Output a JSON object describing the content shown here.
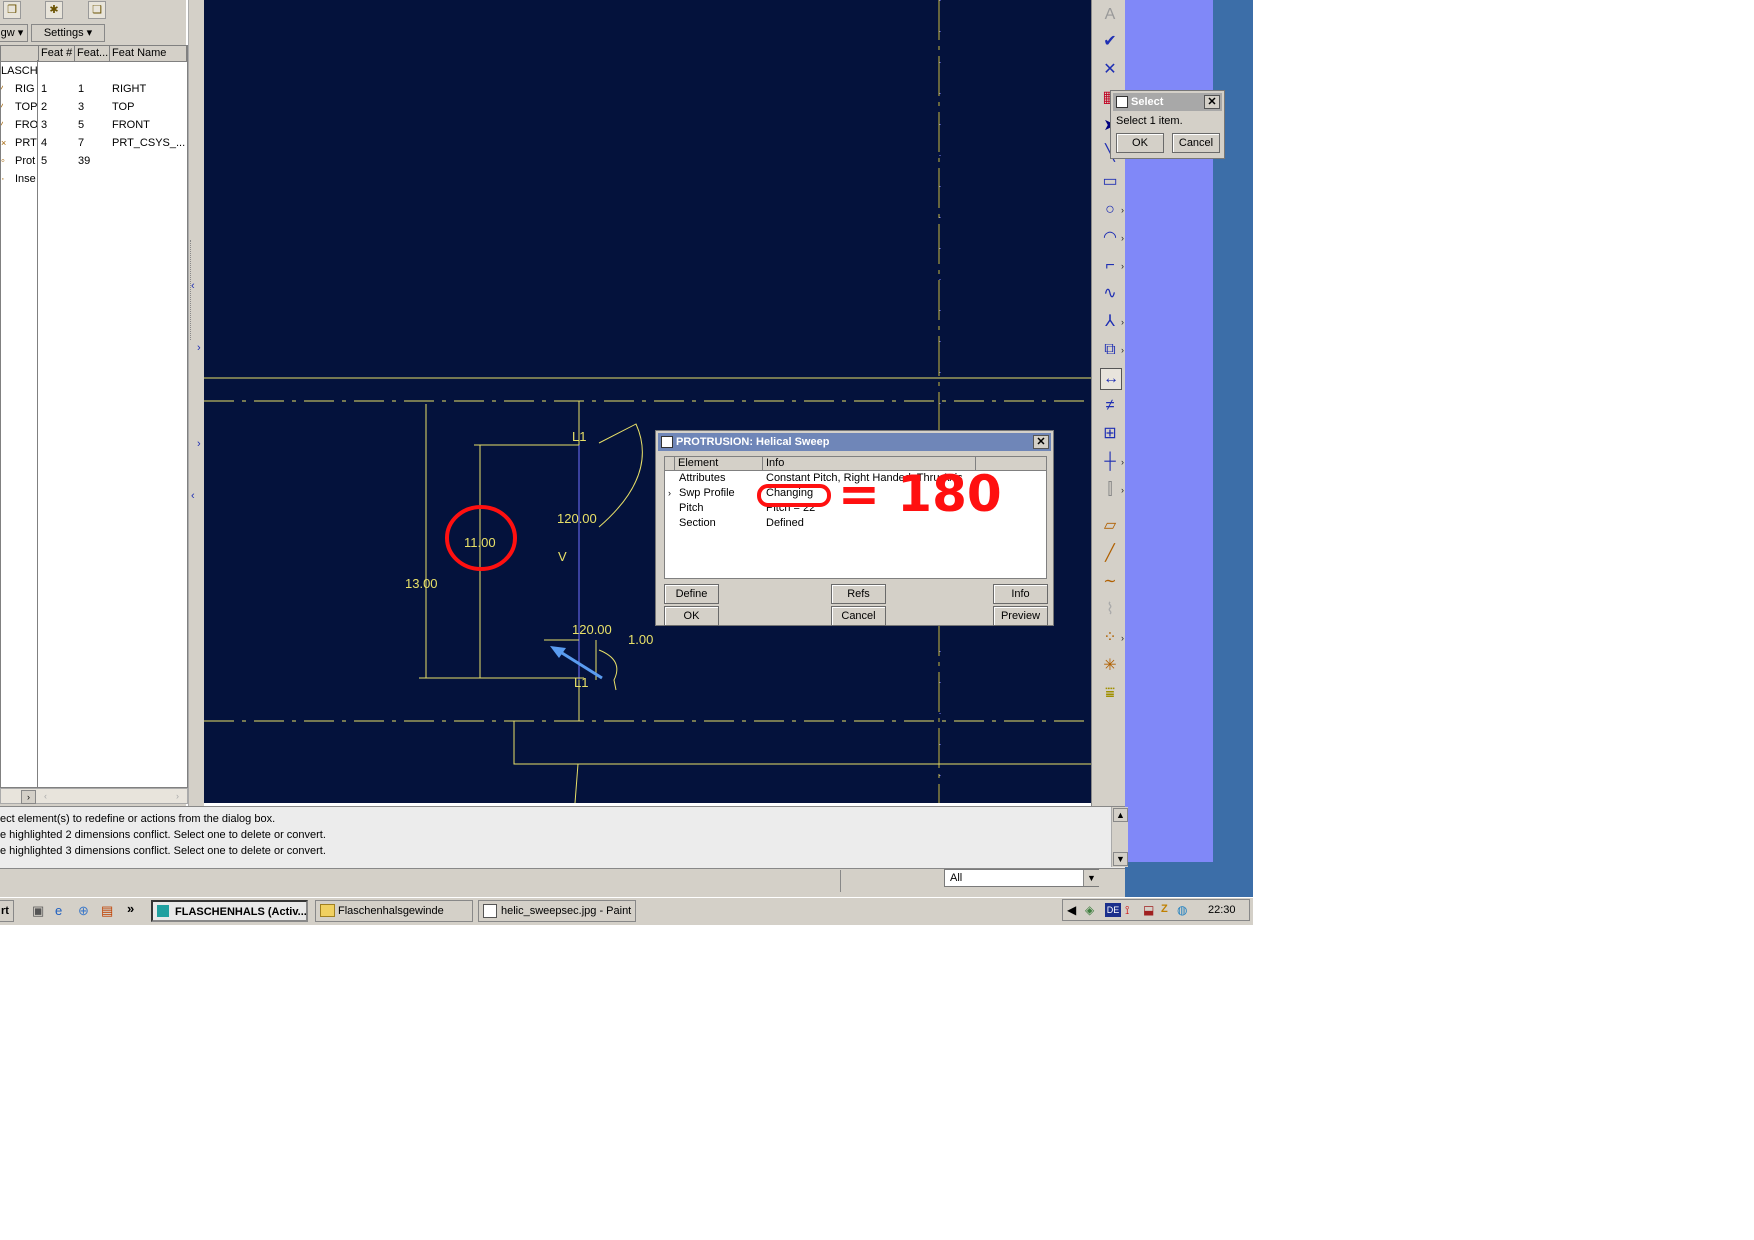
{
  "model_tree": {
    "settings_menu": "Settings",
    "view_menu": "gw",
    "columns": [
      "Feat #",
      "Feat...",
      "Feat Name"
    ],
    "root": "LASCH",
    "rows": [
      {
        "icon": "datum-plane-icon",
        "name": "RIG",
        "feat_no": "1",
        "feat_id": "1",
        "feat_name": "RIGHT"
      },
      {
        "icon": "datum-plane-icon",
        "name": "TOP",
        "feat_no": "2",
        "feat_id": "3",
        "feat_name": "TOP"
      },
      {
        "icon": "datum-plane-icon",
        "name": "FRO",
        "feat_no": "3",
        "feat_id": "5",
        "feat_name": "FRONT"
      },
      {
        "icon": "coordinate-system-icon",
        "name": "PRT",
        "feat_no": "4",
        "feat_id": "7",
        "feat_name": "PRT_CSYS_..."
      },
      {
        "icon": "protrusion-icon",
        "name": "Prot",
        "feat_no": "5",
        "feat_id": "39",
        "feat_name": ""
      },
      {
        "icon": "insert-here-icon",
        "name": "Inse",
        "feat_no": "",
        "feat_id": "",
        "feat_name": ""
      }
    ]
  },
  "sketch": {
    "dimensions": [
      "13.00",
      "11.00",
      "120.00",
      "120.00",
      "1.00"
    ],
    "labels": [
      "L1",
      "V",
      "L1"
    ],
    "colors": {
      "background": "#04123c",
      "geometry": "#e8e068",
      "highlight": "#ff2020"
    }
  },
  "annotation": {
    "text": "= 180 °",
    "color": "#ff1010"
  },
  "protrusion_dialog": {
    "title": "PROTRUSION: Helical Sweep",
    "columns": [
      "Element",
      "Info"
    ],
    "rows": [
      {
        "element": "Attributes",
        "info": "Constant Pitch, Right Handed, Thru Axis"
      },
      {
        "element": "Swp Profile",
        "info": "Changing"
      },
      {
        "element": "Pitch",
        "info": "Pitch = 22"
      },
      {
        "element": "Section",
        "info": "Defined"
      }
    ],
    "buttons": {
      "define": "Define",
      "refs": "Refs",
      "info": "Info",
      "ok": "OK",
      "cancel": "Cancel",
      "preview": "Preview"
    }
  },
  "select_dialog": {
    "title": "Select",
    "message": "Select 1 item.",
    "ok": "OK",
    "cancel": "Cancel"
  },
  "messages": [
    "ect element(s) to redefine or actions from the dialog box.",
    "e highlighted 2 dimensions conflict. Select one to delete or convert.",
    "e highlighted 3 dimensions conflict. Select one to delete or convert."
  ],
  "filter": {
    "value": "All"
  },
  "taskbar": {
    "start": "rt",
    "tasks": [
      {
        "label": "FLASCHENHALS (Activ...",
        "active": true
      },
      {
        "label": "Flaschenhalsgewinde",
        "active": false
      },
      {
        "label": "helic_sweepsec.jpg - Paint",
        "active": false
      }
    ],
    "tray_lang": "DE",
    "clock": "22:30"
  }
}
